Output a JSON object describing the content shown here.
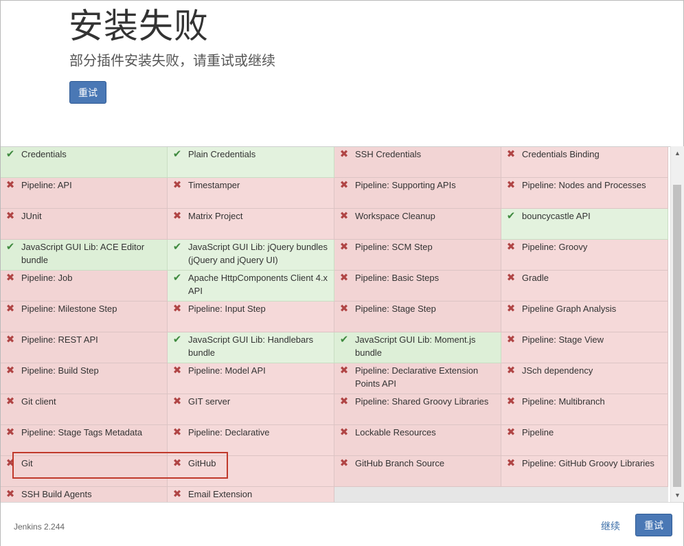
{
  "header": {
    "title": "安装失败",
    "subtitle": "部分插件安装失败，请重试或继续",
    "retry_label": "重试"
  },
  "plugins": [
    {
      "name": "Credentials",
      "status": "ok"
    },
    {
      "name": "Plain Credentials",
      "status": "ok"
    },
    {
      "name": "SSH Credentials",
      "status": "fail"
    },
    {
      "name": "Credentials Binding",
      "status": "fail"
    },
    {
      "name": "Pipeline: API",
      "status": "fail"
    },
    {
      "name": "Timestamper",
      "status": "fail"
    },
    {
      "name": "Pipeline: Supporting APIs",
      "status": "fail"
    },
    {
      "name": "Pipeline: Nodes and Processes",
      "status": "fail"
    },
    {
      "name": "JUnit",
      "status": "fail"
    },
    {
      "name": "Matrix Project",
      "status": "fail"
    },
    {
      "name": "Workspace Cleanup",
      "status": "fail"
    },
    {
      "name": "bouncycastle API",
      "status": "ok"
    },
    {
      "name": "JavaScript GUI Lib: ACE Editor bundle",
      "status": "ok"
    },
    {
      "name": "JavaScript GUI Lib: jQuery bundles (jQuery and jQuery UI)",
      "status": "ok"
    },
    {
      "name": "Pipeline: SCM Step",
      "status": "fail"
    },
    {
      "name": "Pipeline: Groovy",
      "status": "fail"
    },
    {
      "name": "Pipeline: Job",
      "status": "fail"
    },
    {
      "name": "Apache HttpComponents Client 4.x API",
      "status": "ok"
    },
    {
      "name": "Pipeline: Basic Steps",
      "status": "fail"
    },
    {
      "name": "Gradle",
      "status": "fail"
    },
    {
      "name": "Pipeline: Milestone Step",
      "status": "fail"
    },
    {
      "name": "Pipeline: Input Step",
      "status": "fail"
    },
    {
      "name": "Pipeline: Stage Step",
      "status": "fail"
    },
    {
      "name": "Pipeline Graph Analysis",
      "status": "fail"
    },
    {
      "name": "Pipeline: REST API",
      "status": "fail"
    },
    {
      "name": "JavaScript GUI Lib: Handlebars bundle",
      "status": "ok"
    },
    {
      "name": "JavaScript GUI Lib: Moment.js bundle",
      "status": "ok"
    },
    {
      "name": "Pipeline: Stage View",
      "status": "fail"
    },
    {
      "name": "Pipeline: Build Step",
      "status": "fail"
    },
    {
      "name": "Pipeline: Model API",
      "status": "fail"
    },
    {
      "name": "Pipeline: Declarative Extension Points API",
      "status": "fail"
    },
    {
      "name": "JSch dependency",
      "status": "fail"
    },
    {
      "name": "Git client",
      "status": "fail"
    },
    {
      "name": "GIT server",
      "status": "fail"
    },
    {
      "name": "Pipeline: Shared Groovy Libraries",
      "status": "fail"
    },
    {
      "name": "Pipeline: Multibranch",
      "status": "fail"
    },
    {
      "name": "Pipeline: Stage Tags Metadata",
      "status": "fail"
    },
    {
      "name": "Pipeline: Declarative",
      "status": "fail"
    },
    {
      "name": "Lockable Resources",
      "status": "fail"
    },
    {
      "name": "Pipeline",
      "status": "fail"
    },
    {
      "name": "Git",
      "status": "fail"
    },
    {
      "name": "GitHub",
      "status": "fail"
    },
    {
      "name": "GitHub Branch Source",
      "status": "fail"
    },
    {
      "name": "Pipeline: GitHub Groovy Libraries",
      "status": "fail"
    },
    {
      "name": "SSH Build Agents",
      "status": "fail"
    },
    {
      "name": "Email Extension",
      "status": "fail"
    }
  ],
  "icons": {
    "ok": "check-icon",
    "fail": "x-icon"
  },
  "colors": {
    "fail_bg": "#f5d9d9",
    "ok_bg": "#e3f2de",
    "primary": "#4a78b5",
    "highlight": "#c0392b"
  },
  "footer": {
    "version": "Jenkins 2.244",
    "continue_label": "继续",
    "retry_label": "重试"
  }
}
